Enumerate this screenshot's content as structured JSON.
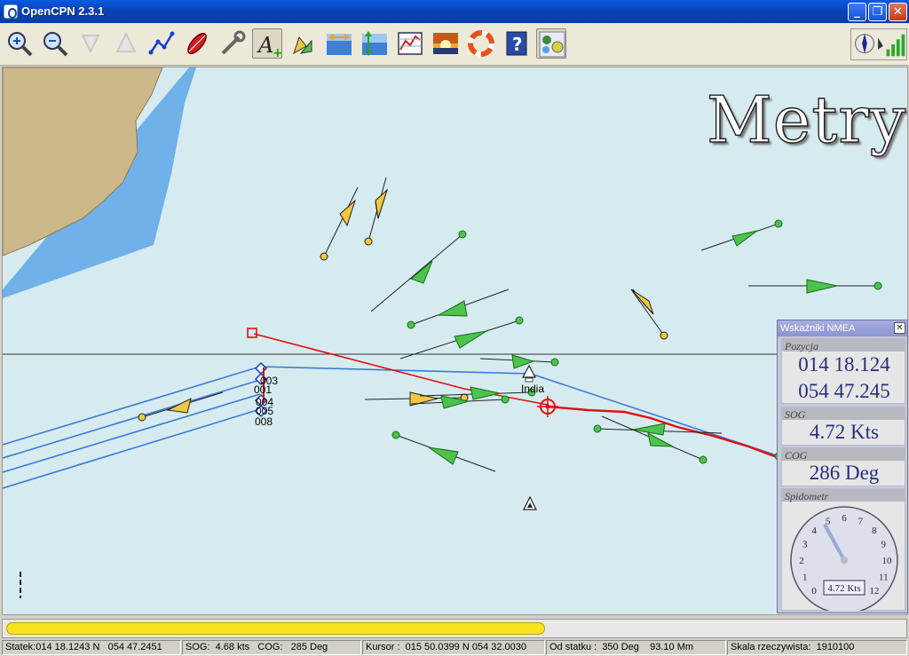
{
  "window": {
    "title": "OpenCPN 2.3.1"
  },
  "toolbar": {
    "buttons": [
      {
        "name": "zoom-in-icon"
      },
      {
        "name": "zoom-out-icon"
      },
      {
        "name": "scale-in-icon"
      },
      {
        "name": "scale-out-icon"
      },
      {
        "name": "route-icon"
      },
      {
        "name": "follow-ship-icon"
      },
      {
        "name": "settings-icon"
      },
      {
        "name": "text-icon"
      },
      {
        "name": "ais-icon"
      },
      {
        "name": "current-icon"
      },
      {
        "name": "tide-icon"
      },
      {
        "name": "print-icon"
      },
      {
        "name": "night-mode-icon"
      },
      {
        "name": "mob-icon"
      },
      {
        "name": "help-icon"
      },
      {
        "name": "nmea-display-icon"
      }
    ]
  },
  "chart": {
    "units_label": "Metry",
    "waypoint_labels": [
      "003",
      "001",
      "004",
      "005",
      "008"
    ],
    "station_label": "India",
    "colors": {
      "water": "#d6ebef",
      "deep_water": "#6fb1e8",
      "land": "#cdb88a",
      "own_track": "#e01010",
      "route": "#3a7ad8"
    }
  },
  "nmea_panel": {
    "title": "Wskaźniki NMEA",
    "position_label": "Pozycja",
    "lat": "014 18.124",
    "lon": "054 47.245",
    "sog_label": "SOG",
    "sog": "4.72 Kts",
    "cog_label": "COG",
    "cog": "286 Deg",
    "speedo_label": "Spidometr",
    "speedo_readout": "4.72 Kts",
    "speedo_ticks": [
      "0",
      "1",
      "2",
      "3",
      "4",
      "5",
      "6",
      "7",
      "8",
      "9",
      "10",
      "11",
      "12"
    ],
    "speedo_value": 4.72
  },
  "progress": {
    "fraction": 0.6
  },
  "status": {
    "ship": "Statek:014 18.1243 N   054 47.2451",
    "sog_cog": "SOG:  4.68 kts   COG:   285 Deg",
    "cursor": "Kursor :  015 50.0399 N 054 32.0030",
    "from_ship": "Od statku :  350 Deg    93.10 Mm",
    "scale": "Skala rzeczywista:  1910100"
  }
}
